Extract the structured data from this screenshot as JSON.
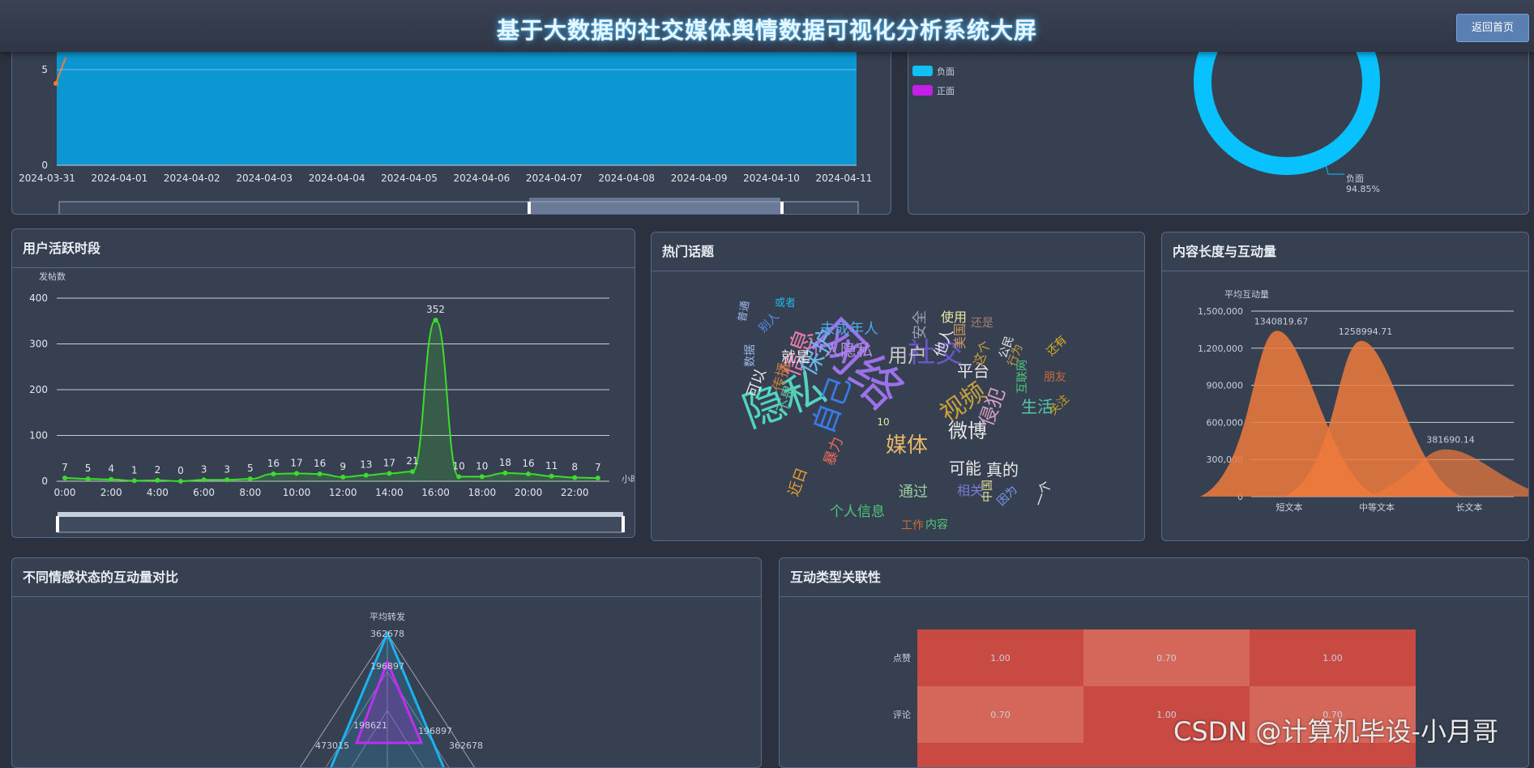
{
  "header": {
    "title": "基于大数据的社交媒体舆情数据可视化分析系统大屏",
    "back_label": "返回首页"
  },
  "trend_panel": {
    "chart_data": {
      "type": "area",
      "x": [
        "2024-03-31",
        "2024-04-01",
        "2024-04-02",
        "2024-04-03",
        "2024-04-04",
        "2024-04-05",
        "2024-04-06",
        "2024-04-07",
        "2024-04-08",
        "2024-04-09",
        "2024-04-10",
        "2024-04-11"
      ],
      "ytick_labels": [
        "0",
        "5"
      ],
      "color": "#0e9bd6"
    }
  },
  "sentiment_panel": {
    "legend": [
      {
        "label": "负面",
        "color": "#10c0f5"
      },
      {
        "label": "正面",
        "color": "#c51ee8"
      }
    ],
    "chart_data": {
      "type": "pie",
      "slices": [
        {
          "name": "负面",
          "value": 94.85
        },
        {
          "name": "正面",
          "value": 5.15
        }
      ],
      "label": {
        "name": "负面",
        "value": "94.85%"
      }
    }
  },
  "active_panel": {
    "title": "用户活跃时段",
    "chart_data": {
      "type": "line",
      "ylabel": "发帖数",
      "xlabel": "小时",
      "ylim": [
        0,
        400
      ],
      "yticks": [
        0,
        100,
        200,
        300,
        400
      ],
      "x": [
        0,
        1,
        2,
        3,
        4,
        5,
        6,
        7,
        8,
        9,
        10,
        11,
        12,
        13,
        14,
        15,
        16,
        17,
        18,
        19,
        20,
        21,
        22,
        23
      ],
      "xtick_labels": [
        "0:00",
        "2:00",
        "4:00",
        "6:00",
        "8:00",
        "10:00",
        "12:00",
        "14:00",
        "16:00",
        "18:00",
        "20:00",
        "22:00"
      ],
      "values": [
        7,
        5,
        4,
        1,
        2,
        0,
        3,
        3,
        5,
        16,
        17,
        16,
        9,
        13,
        17,
        21,
        352,
        10,
        10,
        18,
        16,
        11,
        8,
        7
      ],
      "color": "#3ddc2c"
    }
  },
  "topics_panel": {
    "title": "热门话题",
    "words": [
      "网络",
      "隐私",
      "社交",
      "信息",
      "保护",
      "自己",
      "视频",
      "媒体",
      "微博",
      "用户",
      "个人隐私",
      "未成年人",
      "就是",
      "平台",
      "侵犯",
      "可能",
      "真的",
      "生活",
      "通过",
      "个人信息",
      "暴力",
      "传播",
      "不是",
      "可以",
      "安全",
      "使用",
      "他人",
      "美国",
      "还是",
      "这个",
      "公民",
      "还有",
      "朋友",
      "关注",
      "行为",
      "互联网",
      "近日",
      "工作",
      "内容",
      "相关",
      "中国",
      "因为",
      "一个",
      "数据",
      "别人",
      "或者",
      "普通",
      "10"
    ]
  },
  "length_panel": {
    "title": "内容长度与互动量",
    "chart_data": {
      "type": "area",
      "ylabel": "平均互动量",
      "categories": [
        "短文本",
        "中等文本",
        "长文本"
      ],
      "values": [
        1340819.67,
        1258994.71,
        381690.14
      ],
      "value_labels": [
        "1340819.67",
        "1258994.71",
        "381690.14"
      ],
      "ylim": [
        0,
        1500000
      ],
      "ytick_labels": [
        "0",
        "300,000",
        "600,000",
        "900,000",
        "1,200,000",
        "1,500,000"
      ],
      "color": "#ef7a3c"
    }
  },
  "radar_panel": {
    "title": "不同情感状态的互动量对比",
    "chart_data": {
      "type": "radar",
      "indicator": "平均转发",
      "value_labels": [
        "362678",
        "196897",
        "198621",
        "196897",
        "473015",
        "362678"
      ]
    }
  },
  "corr_panel": {
    "title": "互动类型关联性",
    "chart_data": {
      "type": "heatmap",
      "rows": [
        "点赞",
        "评论"
      ],
      "values": [
        [
          1.0,
          0.7,
          1.0
        ],
        [
          0.7,
          1.0,
          0.7
        ]
      ],
      "value_labels": [
        [
          "1.00",
          "0.70",
          "1.00"
        ],
        [
          "0.70",
          "1.00",
          "0.70"
        ]
      ]
    }
  },
  "watermark": "CSDN @计算机毕设-小月哥"
}
